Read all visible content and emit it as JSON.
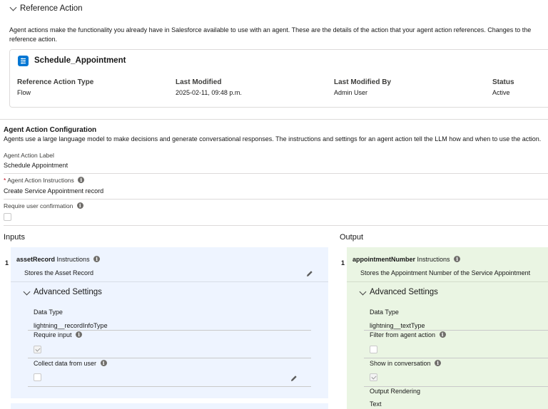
{
  "reference": {
    "section_title": "Reference Action",
    "description": "Agent actions make the functionality you already have in Salesforce available to use with an agent. These are the details of the action that your agent action references. Changes to the reference action.",
    "card": {
      "name": "Schedule_Appointment",
      "fields": [
        {
          "label": "Reference Action Type",
          "value": "Flow"
        },
        {
          "label": "Last Modified",
          "value": "2025-02-11, 09:48 p.m."
        },
        {
          "label": "Last Modified By",
          "value": "Admin User"
        },
        {
          "label": "Status",
          "value": "Active"
        }
      ]
    }
  },
  "config": {
    "title": "Agent Action Configuration",
    "description": "Agents use a large language model to make decisions and generate conversational responses. The instructions and settings for an agent action tell the LLM how and when to use the action.",
    "label_field": {
      "label": "Agent Action Label",
      "value": "Schedule Appointment"
    },
    "instructions_field": {
      "required_mark": "*",
      "label": "Agent Action Instructions",
      "value": "Create Service Appointment record"
    },
    "confirmation_field": {
      "label": "Require user confirmation",
      "checked": false
    }
  },
  "inputs": {
    "title": "Inputs",
    "items": [
      {
        "index": "1",
        "name": "assetRecord",
        "instructions_label": "Instructions",
        "description": "Stores the Asset Record",
        "advanced_title": "Advanced Settings",
        "data_type_label": "Data Type",
        "data_type_value": "lightning__recordInfoType",
        "require_input_label": "Require input",
        "collect_label": "Collect data from user"
      }
    ]
  },
  "output": {
    "title": "Output",
    "items": [
      {
        "index": "1",
        "name": "appointmentNumber",
        "instructions_label": "Instructions",
        "description": "Stores the Appointment Number of the Service Appointment",
        "advanced_title": "Advanced Settings",
        "data_type_label": "Data Type",
        "data_type_value": "lightning__textType",
        "filter_label": "Filter from agent action",
        "show_label": "Show in conversation",
        "rendering_label": "Output Rendering",
        "rendering_value": "Text"
      }
    ]
  },
  "icons": {
    "info": "i",
    "flow_icon_color": "#0176d3",
    "input_panel_bg": "#eef4ff",
    "output_panel_bg": "#eaf5e3"
  }
}
